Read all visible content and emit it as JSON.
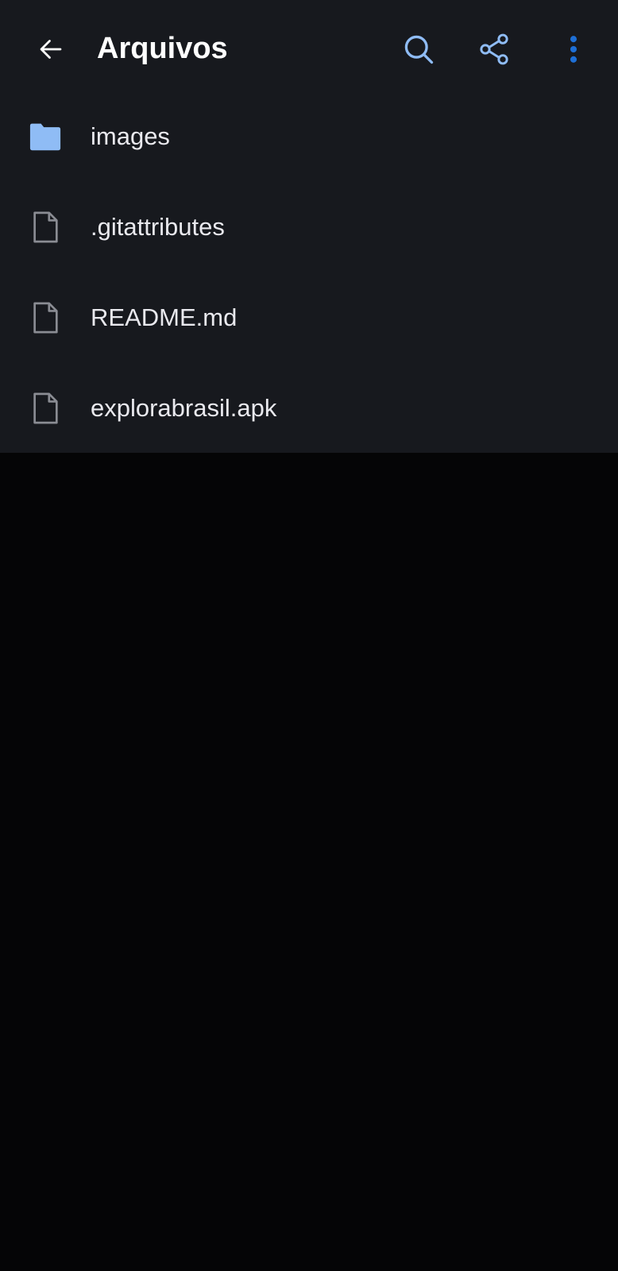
{
  "header": {
    "title": "Arquivos",
    "back_icon": "arrow-left-icon",
    "actions": [
      {
        "name": "search",
        "icon": "search-icon"
      },
      {
        "name": "share",
        "icon": "share-icon"
      },
      {
        "name": "more",
        "icon": "more-vertical-icon"
      }
    ]
  },
  "files": [
    {
      "name": "images",
      "type": "folder",
      "icon": "folder-icon"
    },
    {
      "name": ".gitattributes",
      "type": "file",
      "icon": "file-icon"
    },
    {
      "name": "README.md",
      "type": "file",
      "icon": "file-icon"
    },
    {
      "name": "explorabrasil.apk",
      "type": "file",
      "icon": "file-icon"
    }
  ],
  "colors": {
    "panel_bg": "#17191e",
    "page_bg": "#050506",
    "accent": "#8fbcf5",
    "accent_dark": "#1e6fd6",
    "folder": "#8fbcf5",
    "file_icon": "#8a8c93",
    "text": "#e9e9ee"
  }
}
